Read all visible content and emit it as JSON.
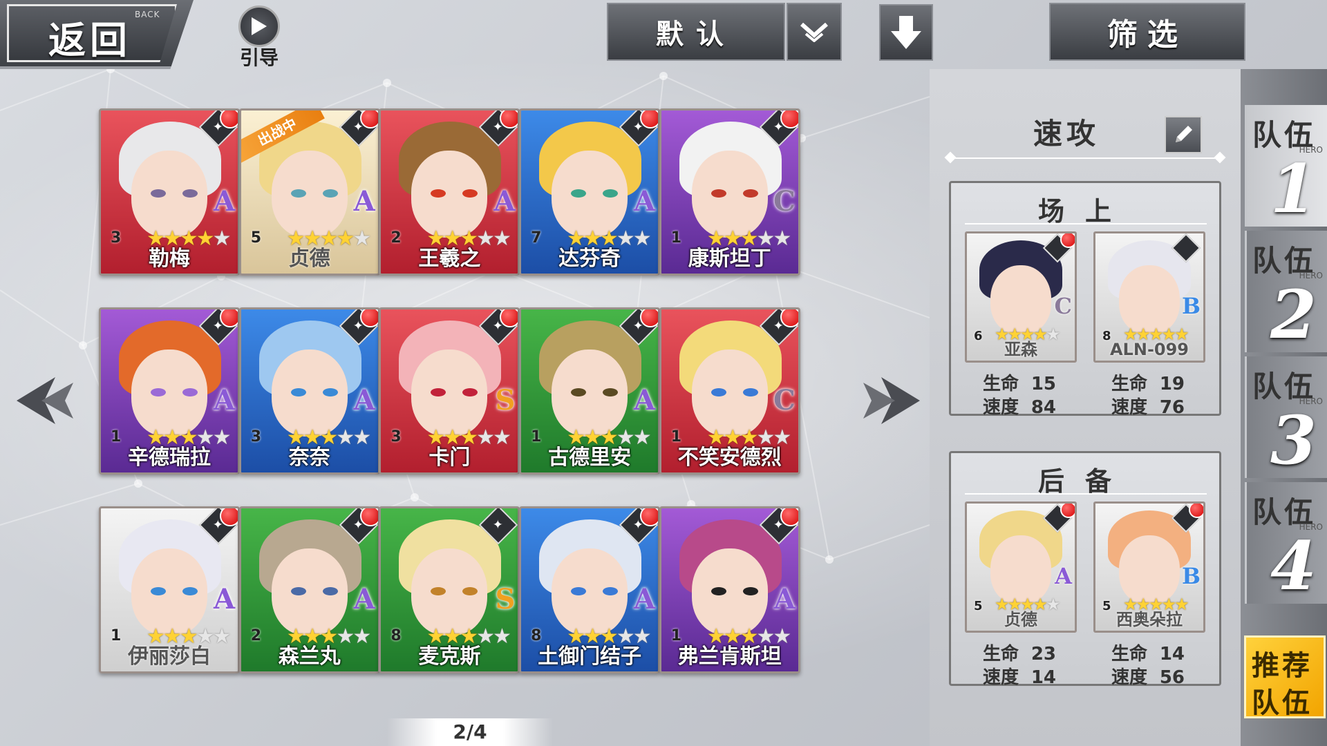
{
  "top": {
    "back_label": "返回",
    "back_sub": "BACK",
    "guide_label": "引导",
    "sort_label": "默认",
    "filter_label": "筛选"
  },
  "grid": {
    "cards": [
      {
        "name": "勒梅",
        "level": "3",
        "grade": "A",
        "stars": 4,
        "max_stars": 5,
        "frame": "red",
        "hair": "#e8e8ea",
        "eye": "#7a6a9a",
        "badge": true,
        "deployed": false
      },
      {
        "name": "贞德",
        "level": "5",
        "grade": "A",
        "stars": 4,
        "max_stars": 5,
        "frame": "gold",
        "hair": "#f0d78a",
        "eye": "#5aa3b5",
        "badge": true,
        "deployed": true
      },
      {
        "name": "王羲之",
        "level": "2",
        "grade": "A",
        "stars": 3,
        "max_stars": 5,
        "frame": "red",
        "hair": "#9a6a36",
        "eye": "#d63a22",
        "badge": true,
        "deployed": false
      },
      {
        "name": "达芬奇",
        "level": "7",
        "grade": "A",
        "stars": 3,
        "max_stars": 5,
        "frame": "blue",
        "hair": "#f3c84a",
        "eye": "#3aa58a",
        "badge": true,
        "deployed": false
      },
      {
        "name": "康斯坦丁",
        "level": "1",
        "grade": "C",
        "stars": 3,
        "max_stars": 5,
        "frame": "purple",
        "hair": "#f2f2f2",
        "eye": "#c23a2a",
        "badge": true,
        "deployed": false
      },
      {
        "name": "辛德瑞拉",
        "level": "1",
        "grade": "A",
        "stars": 3,
        "max_stars": 5,
        "frame": "purple",
        "hair": "#e36a2a",
        "eye": "#9a6ad6",
        "badge": true,
        "deployed": false
      },
      {
        "name": "奈奈",
        "level": "3",
        "grade": "A",
        "stars": 3,
        "max_stars": 5,
        "frame": "blue",
        "hair": "#9ec8f0",
        "eye": "#3a8ad6",
        "badge": true,
        "deployed": false
      },
      {
        "name": "卡门",
        "level": "3",
        "grade": "S",
        "stars": 3,
        "max_stars": 5,
        "frame": "red",
        "hair": "#f3b3b8",
        "eye": "#c2223a",
        "badge": true,
        "deployed": false
      },
      {
        "name": "古德里安",
        "level": "1",
        "grade": "A",
        "stars": 3,
        "max_stars": 5,
        "frame": "green",
        "hair": "#b8a060",
        "eye": "#5a4a22",
        "badge": true,
        "deployed": false
      },
      {
        "name": "不笑安德烈",
        "level": "1",
        "grade": "C",
        "stars": 3,
        "max_stars": 5,
        "frame": "red",
        "hair": "#f3da7a",
        "eye": "#3a7ad6",
        "badge": true,
        "deployed": false
      },
      {
        "name": "伊丽莎白",
        "level": "1",
        "grade": "A",
        "stars": 3,
        "max_stars": 5,
        "frame": "white",
        "hair": "#e8e8f2",
        "eye": "#3a8ad6",
        "badge": true,
        "deployed": false
      },
      {
        "name": "森兰丸",
        "level": "2",
        "grade": "A",
        "stars": 3,
        "max_stars": 5,
        "frame": "green",
        "hair": "#b8a890",
        "eye": "#4a6aa6",
        "badge": true,
        "deployed": false
      },
      {
        "name": "麦克斯",
        "level": "8",
        "grade": "S",
        "stars": 3,
        "max_stars": 5,
        "frame": "green",
        "hair": "#f0e0a0",
        "eye": "#c2822a",
        "badge": false,
        "deployed": false
      },
      {
        "name": "土御门结子",
        "level": "8",
        "grade": "A",
        "stars": 3,
        "max_stars": 5,
        "frame": "blue",
        "hair": "#dfe6f2",
        "eye": "#3a7ad6",
        "badge": true,
        "deployed": false
      },
      {
        "name": "弗兰肯斯坦",
        "level": "1",
        "grade": "A",
        "stars": 3,
        "max_stars": 5,
        "frame": "purple",
        "hair": "#b84a8a",
        "eye": "#222222",
        "badge": true,
        "deployed": false
      }
    ],
    "deployed_label": "出战中",
    "page": "2/4"
  },
  "team": {
    "name": "速攻",
    "front": {
      "title": "场上",
      "members": [
        {
          "name": "亚森",
          "level": "6",
          "grade": "C",
          "stars": 4,
          "max_stars": 5,
          "hp_label": "生命",
          "hp": "15",
          "spd_label": "速度",
          "spd": "84",
          "hair": "#2a2a4a",
          "badge": true
        },
        {
          "name": "ALN-099",
          "level": "8",
          "grade": "B",
          "stars": 5,
          "max_stars": 5,
          "hp_label": "生命",
          "hp": "19",
          "spd_label": "速度",
          "spd": "76",
          "hair": "#e6e6ee",
          "badge": false
        }
      ]
    },
    "reserve": {
      "title": "后备",
      "members": [
        {
          "name": "贞德",
          "level": "5",
          "grade": "A",
          "stars": 4,
          "max_stars": 5,
          "hp_label": "生命",
          "hp": "23",
          "spd_label": "速度",
          "spd": "14",
          "hair": "#f0d78a",
          "badge": true
        },
        {
          "name": "西奥朵拉",
          "level": "5",
          "grade": "B",
          "stars": 5,
          "max_stars": 5,
          "hp_label": "生命",
          "hp": "14",
          "spd_label": "速度",
          "spd": "56",
          "hair": "#f3b080",
          "badge": true
        }
      ]
    }
  },
  "tabs": [
    {
      "label": "队伍",
      "sub": "HERO",
      "num": "1",
      "active": true
    },
    {
      "label": "队伍",
      "sub": "HERO",
      "num": "2",
      "active": false
    },
    {
      "label": "队伍",
      "sub": "HERO",
      "num": "3",
      "active": false
    },
    {
      "label": "队伍",
      "sub": "HERO",
      "num": "4",
      "active": false
    }
  ],
  "recommend": {
    "line1": "推荐",
    "line2": "队伍"
  }
}
